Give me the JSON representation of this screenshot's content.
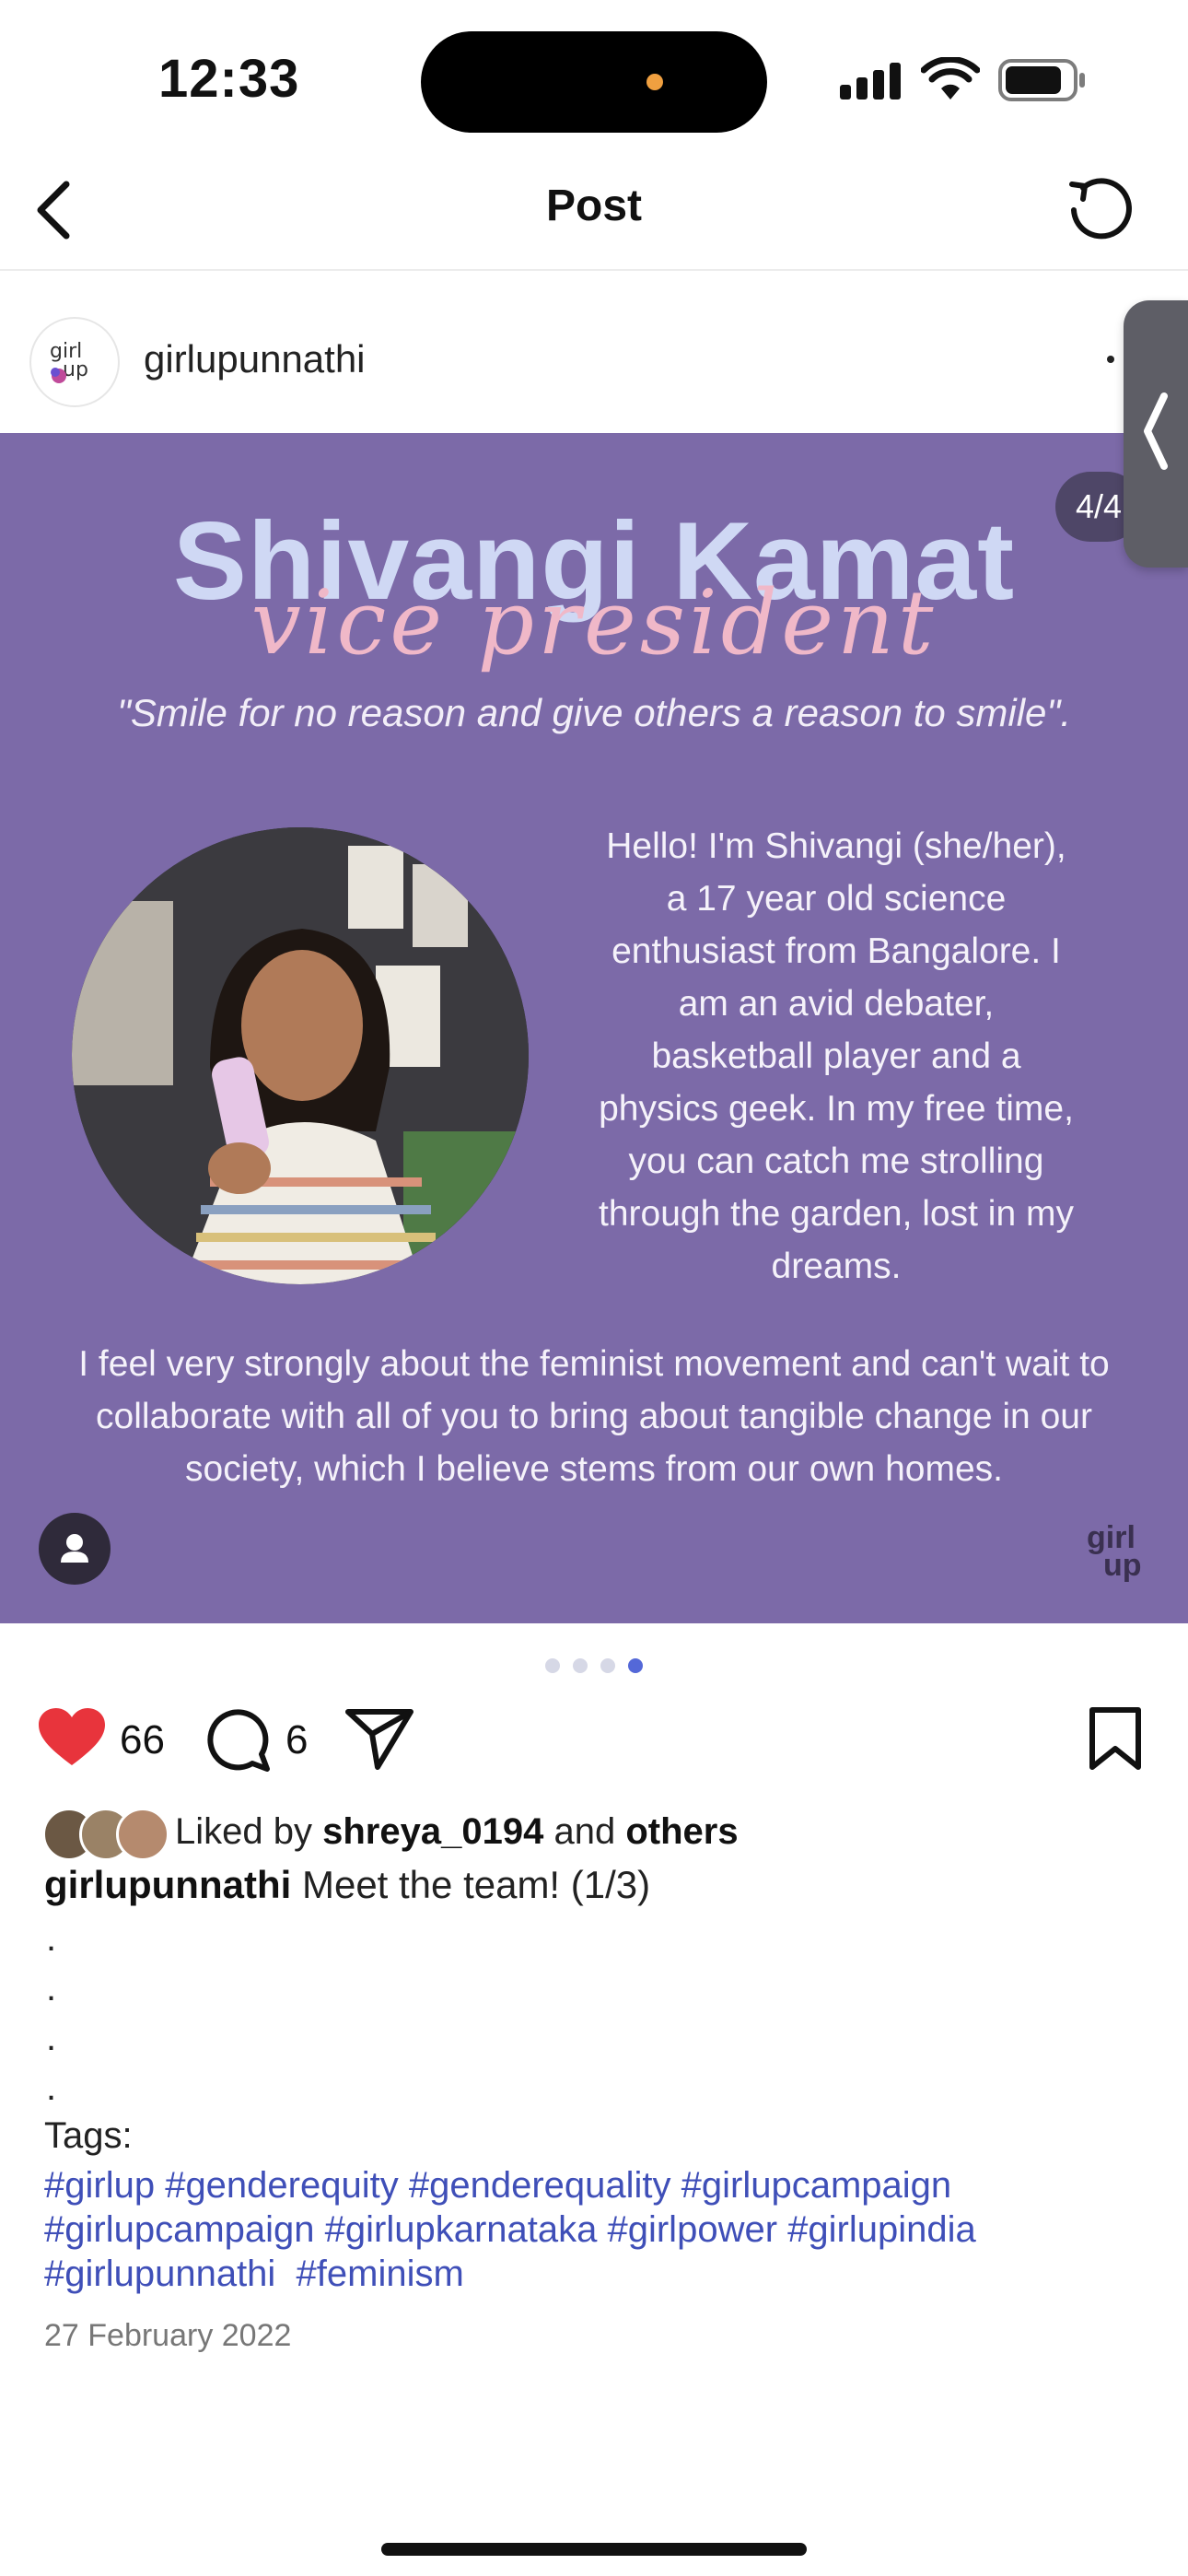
{
  "status_bar": {
    "time": "12:33"
  },
  "nav": {
    "title": "Post"
  },
  "post": {
    "username": "girlupunnathi",
    "image": {
      "counter": "4/4",
      "name": "Shivangi Kamat",
      "role": "vice president",
      "quote": "\"Smile for no reason and give others a reason to smile\".",
      "bio_lines": [
        "Hello! I'm Shivangi (she/her),",
        "a 17 year old science",
        "enthusiast from Bangalore. I",
        "am an avid debater,",
        "basketball player and a",
        "physics geek. In my free time,",
        "you can catch me strolling",
        "through the garden, lost in my",
        "dreams."
      ],
      "paragraph_lines": [
        "I feel very strongly about the feminist movement and can't wait to",
        "collaborate with all of you to bring about tangible change in our",
        "society, which I believe stems from our own homes."
      ],
      "watermark_top": "girl",
      "watermark_bottom": "up"
    },
    "carousel": {
      "total": 4,
      "active_index": 4
    },
    "likes_count": "66",
    "comments_count": "6",
    "liked_by": {
      "prefix": "Liked by",
      "user": "shreya_0194",
      "joiner": "and",
      "others": "others"
    },
    "caption": {
      "username": "girlupunnathi",
      "text": "Meet the team! (1/3)"
    },
    "dot_lines": [
      ".",
      ".",
      ".",
      "."
    ],
    "tags_label": "Tags:",
    "hashtag_lines": [
      "#girlup #genderequity #genderequality #girlupcampaign",
      "#girlupcampaign #girlupkarnataka #girlpower #girlupindia",
      "#girlupunnathi  #feminism"
    ],
    "date": "27 February 2022"
  },
  "icons": {
    "back": "chevron-left-icon",
    "refresh": "refresh-icon",
    "like": "heart-icon",
    "comment": "comment-icon",
    "share": "send-icon",
    "save": "bookmark-icon"
  },
  "colors": {
    "heart": "#e8343c",
    "hashtag": "#3f4fb8",
    "image_bg": "#7c6aa8",
    "active_dot": "#5468d8"
  }
}
